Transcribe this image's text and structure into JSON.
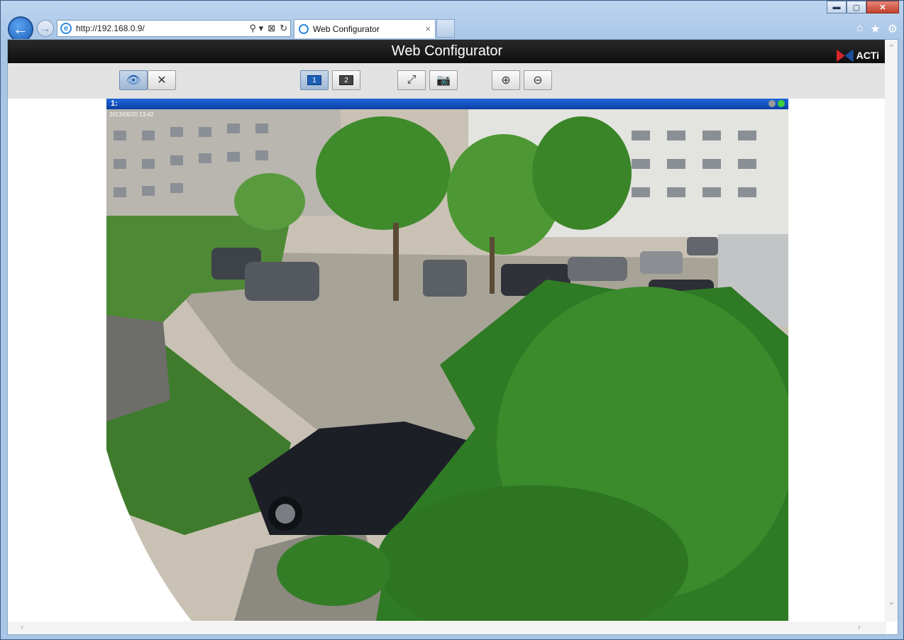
{
  "browser": {
    "address": "http://192.168.0.9/",
    "tab_title": "Web Configurator",
    "tab_close": "×",
    "back_icon": "←",
    "forward_icon": "→",
    "window_controls": {
      "minimize": "▬",
      "maximize": "▢",
      "close": "✕"
    },
    "toolbar_icons": {
      "home": "⌂",
      "favorites": "★",
      "settings": "⚙"
    },
    "address_tools": [
      "⚲ ▾",
      "⊠",
      "↻"
    ]
  },
  "page": {
    "header_title": "Web Configurator",
    "logo_text": "ACTi",
    "toolbar": {
      "live_view_icon": "👁",
      "setup_icon": "✕",
      "layout1_label": "1",
      "layout2_label": "2",
      "fullscreen_icon": "⤢",
      "snapshot_icon": "📷",
      "zoom_in_icon": "⊕",
      "zoom_out_icon": "⊖"
    },
    "video": {
      "channel_label": "1:",
      "timestamp_overlay": "2013/06/20 13:42"
    },
    "scroll": {
      "left": "‹",
      "right": "›",
      "down": "⌄"
    }
  },
  "colors": {
    "header_bg": "#111111",
    "toolbar_bg": "#e2e2e2",
    "video_title_bar": "#0c3fa5",
    "active_button": "#9eb7d5"
  }
}
